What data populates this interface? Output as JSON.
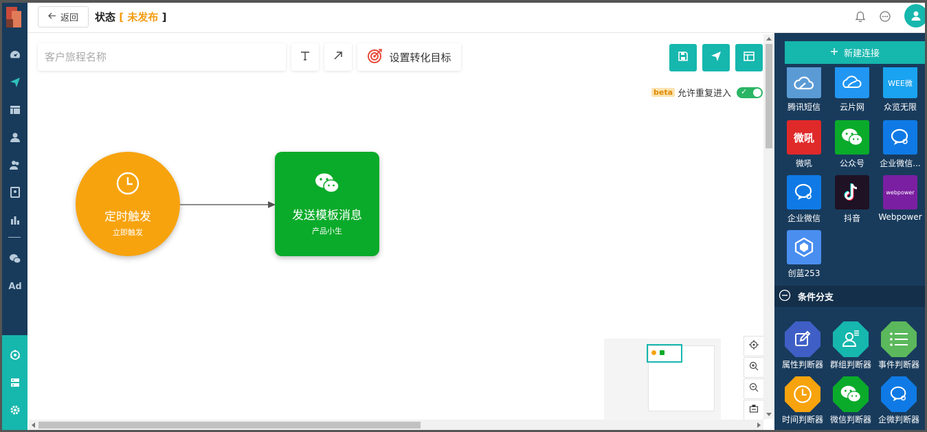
{
  "header": {
    "back_label": "返回",
    "status_label": "状态",
    "status_open": "[",
    "status_value": "未发布",
    "status_close": "]"
  },
  "toolbar": {
    "name_placeholder": "客户旅程名称",
    "goal_label": "设置转化目标",
    "beta_badge": "beta",
    "repeat_label": "允许重复进入",
    "repeat_enabled": true
  },
  "nodes": {
    "trigger": {
      "title": "定时触发",
      "sub": "立即触发"
    },
    "send": {
      "title": "发送模板消息",
      "sub": "产品小生"
    }
  },
  "panel": {
    "new_connection_label": "新建连接",
    "channels": [
      {
        "label": "腾讯短信",
        "color": "#5b9bd5",
        "icon": "tencent-cloud-icon"
      },
      {
        "label": "云片网",
        "color": "#2196f3",
        "icon": "yunpian-icon"
      },
      {
        "label": "众览无限",
        "color": "#1aa3f0",
        "icon": "zhonglan-icon",
        "tile_text": "WEE微"
      },
      {
        "label": "微吼",
        "color": "#e02a2a",
        "icon": "weihou-icon",
        "tile_text": "微吼"
      },
      {
        "label": "公众号",
        "color": "#0aab2a",
        "icon": "wechat-icon"
      },
      {
        "label": "企业微信...",
        "color": "#0f7ae5",
        "icon": "wecom-icon"
      },
      {
        "label": "企业微信",
        "color": "#0f7ae5",
        "icon": "wecom-icon"
      },
      {
        "label": "抖音",
        "color": "#1e1224",
        "icon": "douyin-icon"
      },
      {
        "label": "Webpower",
        "color": "#7b1fa2",
        "icon": "webpower-icon",
        "tile_text": "webpower"
      },
      {
        "label": "创蓝253",
        "color": "#4a8ef0",
        "icon": "chuanglan-icon"
      }
    ],
    "section_label": "条件分支",
    "judges": [
      {
        "label": "属性判断器",
        "color": "#3f5fc6",
        "icon": "edit-icon"
      },
      {
        "label": "群组判断器",
        "color": "#16b7ad",
        "icon": "group-icon"
      },
      {
        "label": "事件判断器",
        "color": "#5cb85c",
        "icon": "list-icon"
      },
      {
        "label": "时间判断器",
        "color": "#f7a30e",
        "icon": "clock-icon"
      },
      {
        "label": "微信判断器",
        "color": "#0aab2a",
        "icon": "wechat-icon"
      },
      {
        "label": "企微判断器",
        "color": "#0f7ae5",
        "icon": "wecom-icon"
      }
    ]
  },
  "colors": {
    "brand": "#16b7ad",
    "sidebar": "#183b5c",
    "status": "#f39c12",
    "trigger_node": "#f7a30e",
    "send_node": "#0aab2a"
  }
}
